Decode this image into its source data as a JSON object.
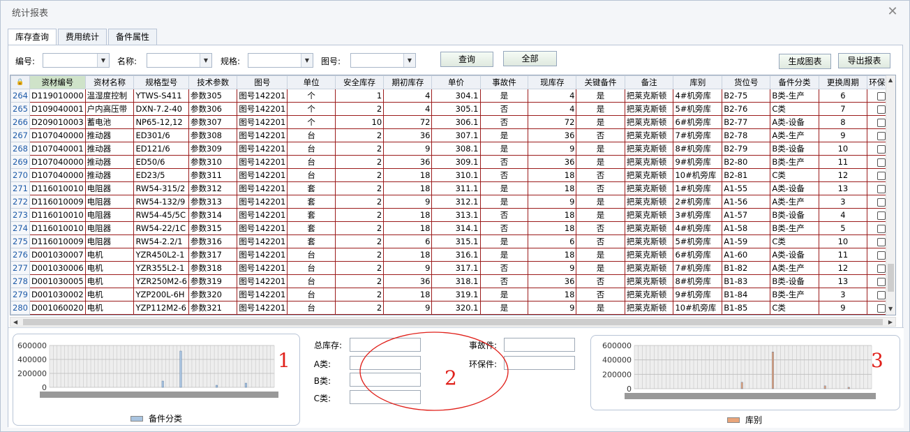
{
  "window": {
    "title": "统计报表"
  },
  "tabs": [
    {
      "label": "库存查询",
      "active": true
    },
    {
      "label": "费用统计",
      "active": false
    },
    {
      "label": "备件属性",
      "active": false
    }
  ],
  "filters": {
    "code_label": "编号:",
    "name_label": "名称:",
    "spec_label": "规格:",
    "drawing_label": "图号:",
    "query_button": "查询",
    "all_button": "全部",
    "gen_chart_button": "生成图表",
    "export_button": "导出报表"
  },
  "grid": {
    "columns": [
      "资材编号",
      "资材名称",
      "规格型号",
      "技术参数",
      "图号",
      "单位",
      "安全库存",
      "期初库存",
      "单价",
      "事故件",
      "现库存",
      "关键备件",
      "备注",
      "库别",
      "货位号",
      "备件分类",
      "更换周期",
      "环保备"
    ],
    "rows": [
      [
        "264",
        "D119010000",
        "温湿度控制",
        "YTWS-S411",
        "参数305",
        "图号142201",
        "个",
        "1",
        "4",
        "304.1",
        "是",
        "4",
        "是",
        "把莱克斯顿",
        "4#机旁库",
        "B2-75",
        "B类-生产",
        "6"
      ],
      [
        "265",
        "D109040001",
        "户内高压带",
        "DXN-7.2-40",
        "参数306",
        "图号142201",
        "个",
        "2",
        "4",
        "305.1",
        "否",
        "4",
        "是",
        "把莱克斯顿",
        "5#机旁库",
        "B2-76",
        "C类",
        "7"
      ],
      [
        "266",
        "D209010003",
        "蓄电池",
        "NP65-12,12",
        "参数307",
        "图号142201",
        "个",
        "10",
        "72",
        "306.1",
        "否",
        "72",
        "是",
        "把莱克斯顿",
        "6#机旁库",
        "B2-77",
        "A类-设备",
        "8"
      ],
      [
        "267",
        "D107040000",
        "推动器",
        "ED301/6",
        "参数308",
        "图号142201",
        "台",
        "2",
        "36",
        "307.1",
        "是",
        "36",
        "否",
        "把莱克斯顿",
        "7#机旁库",
        "B2-78",
        "A类-生产",
        "9"
      ],
      [
        "268",
        "D107040001",
        "推动器",
        "ED121/6",
        "参数309",
        "图号142201",
        "台",
        "2",
        "9",
        "308.1",
        "是",
        "9",
        "是",
        "把莱克斯顿",
        "8#机旁库",
        "B2-79",
        "B类-设备",
        "10"
      ],
      [
        "269",
        "D107040000",
        "推动器",
        "ED50/6",
        "参数310",
        "图号142201",
        "台",
        "2",
        "36",
        "309.1",
        "否",
        "36",
        "是",
        "把莱克斯顿",
        "9#机旁库",
        "B2-80",
        "B类-生产",
        "11"
      ],
      [
        "270",
        "D107040000",
        "推动器",
        "ED23/5",
        "参数311",
        "图号142201",
        "台",
        "2",
        "18",
        "310.1",
        "否",
        "18",
        "否",
        "把莱克斯顿",
        "10#机旁库",
        "B2-81",
        "C类",
        "12"
      ],
      [
        "271",
        "D116010010",
        "电阻器",
        "RW54-315/2",
        "参数312",
        "图号142201",
        "套",
        "2",
        "18",
        "311.1",
        "是",
        "18",
        "否",
        "把莱克斯顿",
        "1#机旁库",
        "A1-55",
        "A类-设备",
        "13"
      ],
      [
        "272",
        "D116010009",
        "电阻器",
        "RW54-132/9",
        "参数313",
        "图号142201",
        "套",
        "2",
        "9",
        "312.1",
        "是",
        "9",
        "是",
        "把莱克斯顿",
        "2#机旁库",
        "A1-56",
        "A类-生产",
        "3"
      ],
      [
        "273",
        "D116010010",
        "电阻器",
        "RW54-45/5C",
        "参数314",
        "图号142201",
        "套",
        "2",
        "18",
        "313.1",
        "否",
        "18",
        "是",
        "把莱克斯顿",
        "3#机旁库",
        "A1-57",
        "B类-设备",
        "4"
      ],
      [
        "274",
        "D116010010",
        "电阻器",
        "RW54-22/1C",
        "参数315",
        "图号142201",
        "套",
        "2",
        "18",
        "314.1",
        "否",
        "18",
        "否",
        "把莱克斯顿",
        "4#机旁库",
        "A1-58",
        "B类-生产",
        "5"
      ],
      [
        "275",
        "D116010009",
        "电阻器",
        "RW54-2.2/1",
        "参数316",
        "图号142201",
        "套",
        "2",
        "6",
        "315.1",
        "是",
        "6",
        "否",
        "把莱克斯顿",
        "5#机旁库",
        "A1-59",
        "C类",
        "10"
      ],
      [
        "276",
        "D001030007",
        "电机",
        "YZR450L2-1",
        "参数317",
        "图号142201",
        "台",
        "2",
        "18",
        "316.1",
        "是",
        "18",
        "是",
        "把莱克斯顿",
        "6#机旁库",
        "A1-60",
        "A类-设备",
        "11"
      ],
      [
        "277",
        "D001030006",
        "电机",
        "YZR355L2-1",
        "参数318",
        "图号142201",
        "台",
        "2",
        "9",
        "317.1",
        "否",
        "9",
        "是",
        "把莱克斯顿",
        "7#机旁库",
        "B1-82",
        "A类-生产",
        "12"
      ],
      [
        "278",
        "D001030005",
        "电机",
        "YZR250M2-6",
        "参数319",
        "图号142201",
        "台",
        "2",
        "36",
        "318.1",
        "否",
        "36",
        "否",
        "把莱克斯顿",
        "8#机旁库",
        "B1-83",
        "B类-设备",
        "13"
      ],
      [
        "279",
        "D001030002",
        "电机",
        "YZP200L-6H",
        "参数320",
        "图号142201",
        "台",
        "2",
        "18",
        "319.1",
        "是",
        "18",
        "否",
        "把莱克斯顿",
        "9#机旁库",
        "B1-84",
        "B类-生产",
        "3"
      ],
      [
        "280",
        "D001060020",
        "电机",
        "YZP112M2-6",
        "参数321",
        "图号142201",
        "台",
        "2",
        "9",
        "320.1",
        "是",
        "9",
        "是",
        "把莱克斯顿",
        "10#机旁库",
        "B1-85",
        "C类",
        "9"
      ]
    ]
  },
  "summary": {
    "total_label": "总库存:",
    "a_label": "A类:",
    "b_label": "B类:",
    "c_label": "C类:",
    "accident_label": "事故件:",
    "eco_label": "环保件:"
  },
  "annotations": {
    "mark1": "1",
    "mark2": "2",
    "mark3": "3"
  },
  "chart_data": [
    {
      "type": "bar",
      "legend": "备件分类",
      "ylim": [
        0,
        600000
      ],
      "yticks": [
        "600000",
        "400000",
        "200000",
        "0"
      ],
      "color": "#a9c4e0",
      "bars": [
        {
          "pos": 0.5,
          "value": 90000
        },
        {
          "pos": 0.58,
          "value": 520000
        },
        {
          "pos": 0.74,
          "value": 30000
        },
        {
          "pos": 0.87,
          "value": 60000
        }
      ]
    },
    {
      "type": "bar",
      "legend": "库别",
      "ylim": [
        0,
        600000
      ],
      "yticks": [
        "600000",
        "400000",
        "200000",
        "0"
      ],
      "color": "#e9a57a",
      "bars": [
        {
          "pos": 0.45,
          "value": 90000
        },
        {
          "pos": 0.58,
          "value": 510000
        },
        {
          "pos": 0.8,
          "value": 40000
        },
        {
          "pos": 0.9,
          "value": 20000
        }
      ]
    }
  ]
}
